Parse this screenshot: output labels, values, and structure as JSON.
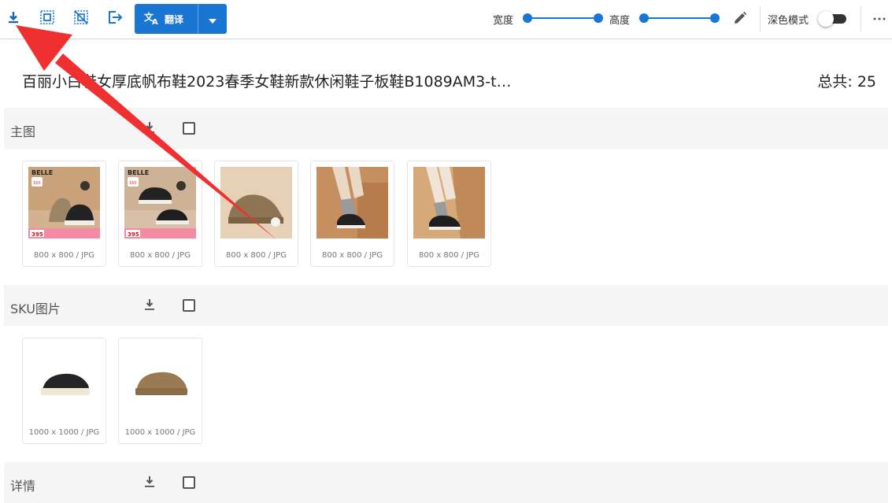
{
  "toolbar": {
    "translate_label": "翻译",
    "width_label": "宽度",
    "height_label": "高度",
    "dark_mode_label": "深色模式",
    "accent_color": "#1976d2",
    "icons": [
      "download-icon",
      "select-all-icon",
      "deselect-icon",
      "export-icon",
      "translate-icon",
      "caret-down-icon",
      "pencil-icon",
      "more-icon"
    ]
  },
  "product": {
    "title": "百丽小白鞋女厚底帆布鞋2023春季女鞋新款休闲鞋子板鞋B1089AM3-t…",
    "total": "总共: 25"
  },
  "sections": {
    "main": {
      "label": "主图",
      "images": [
        {
          "caption": "800 x 800 / JPG"
        },
        {
          "caption": "800 x 800 / JPG"
        },
        {
          "caption": "800 x 800 / JPG"
        },
        {
          "caption": "800 x 800 / JPG"
        },
        {
          "caption": "800 x 800 / JPG"
        }
      ]
    },
    "sku": {
      "label": "SKU图片",
      "images": [
        {
          "caption": "1000 x 1000 / JPG"
        },
        {
          "caption": "1000 x 1000 / JPG"
        }
      ]
    },
    "detail": {
      "label": "详情"
    }
  },
  "thumb_text": {
    "brand": "BELLE",
    "badge": "160",
    "price": "395"
  },
  "annotation": {
    "arrow_color": "#f03030"
  }
}
